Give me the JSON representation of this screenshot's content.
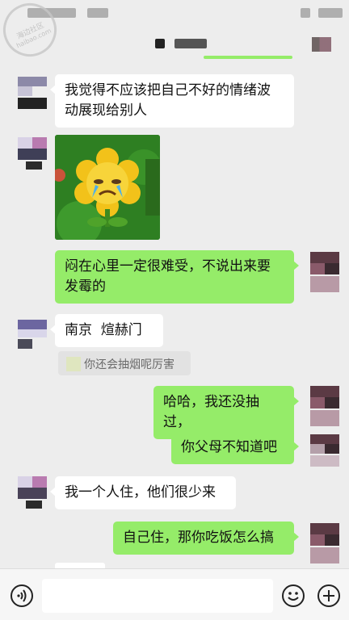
{
  "watermark": {
    "line1": "海边社区",
    "line2": "haibao.com"
  },
  "messages": [
    {
      "side": "in",
      "lines": [
        "我觉得不应该把自己不好的情绪波",
        "动展现给别人"
      ]
    },
    {
      "side": "in",
      "type": "sticker",
      "sticker": "crying-sunflower-sticker"
    },
    {
      "side": "out",
      "lines": [
        "闷在心里一定很难受，不说出来要",
        "发霉的"
      ]
    },
    {
      "side": "in",
      "lines": [
        "南京  煊赫门"
      ]
    },
    {
      "side": "in",
      "type": "quote",
      "lines": [
        "你还会抽烟呢厉害"
      ]
    },
    {
      "side": "out",
      "lines": [
        "哈哈，我还没抽过，"
      ]
    },
    {
      "side": "out",
      "lines": [
        "你父母不知道吧"
      ]
    },
    {
      "side": "in",
      "lines": [
        "我一个人住，他们很少来"
      ]
    },
    {
      "side": "out",
      "lines": [
        "自己住，那你吃饭怎么搞"
      ]
    }
  ],
  "input": {
    "placeholder": ""
  },
  "icons": {
    "voice": "voice-icon",
    "emoji": "emoji-icon",
    "plus": "plus-icon",
    "more": "more-icon"
  },
  "colors": {
    "outgoing": "#95ec69",
    "incoming": "#ffffff",
    "background": "#ededed"
  }
}
